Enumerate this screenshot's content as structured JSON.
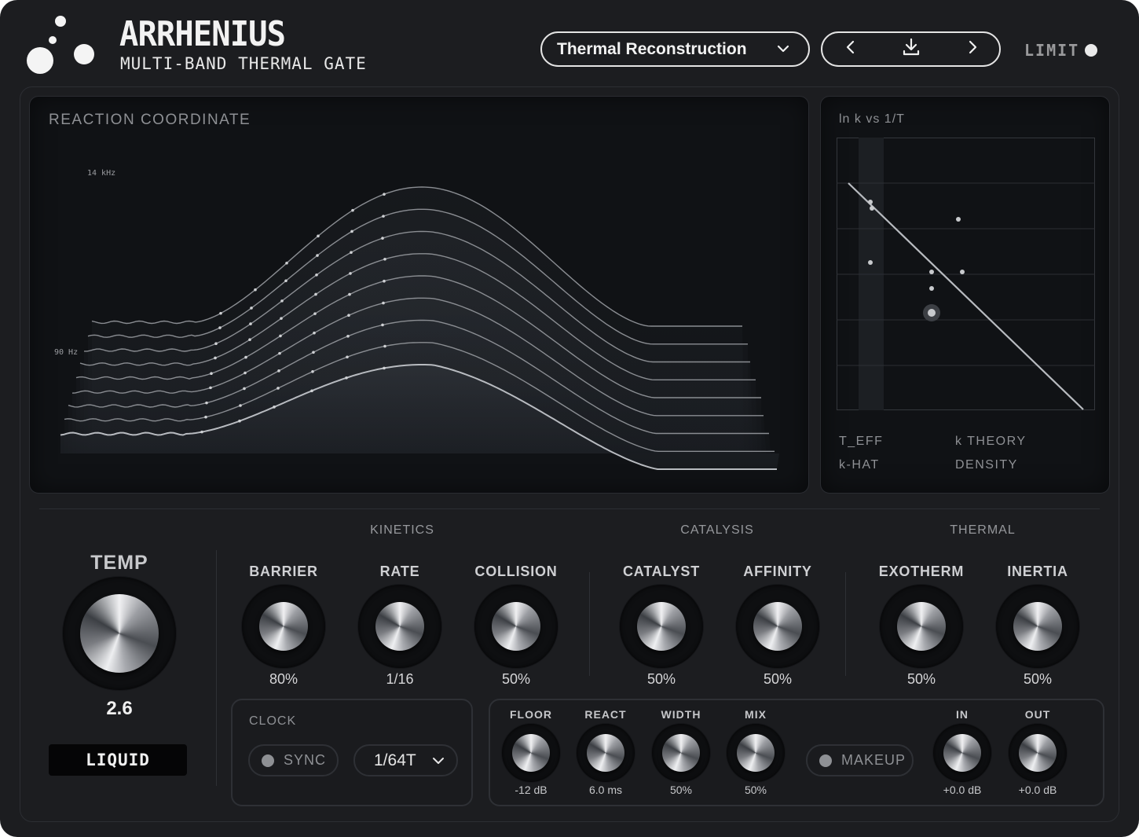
{
  "brand": {
    "title": "ARRHENIUS",
    "subtitle": "MULTI-BAND THERMAL GATE"
  },
  "header": {
    "preset_name": "Thermal Reconstruction",
    "limit_label": "LIMIT",
    "icons": [
      "chevron-down-icon",
      "chevron-left-icon",
      "download-icon",
      "chevron-right-icon"
    ]
  },
  "reaction_panel": {
    "title": "REACTION COORDINATE",
    "freq_top": "14 kHz",
    "freq_mid": "90 Hz"
  },
  "arrhenius_panel": {
    "title": "ln k vs 1/T",
    "stats": [
      "T_EFF",
      "k THEORY",
      "k-HAT",
      "DENSITY"
    ]
  },
  "sections": {
    "kinetics": "KINETICS",
    "catalysis": "CATALYSIS",
    "thermal": "THERMAL"
  },
  "temp": {
    "label": "TEMP",
    "value": "2.6",
    "state": "LIQUID"
  },
  "knobs": [
    {
      "label": "BARRIER",
      "value": "80%"
    },
    {
      "label": "RATE",
      "value": "1/16"
    },
    {
      "label": "COLLISION",
      "value": "50%"
    },
    {
      "label": "CATALYST",
      "value": "50%"
    },
    {
      "label": "AFFINITY",
      "value": "50%"
    },
    {
      "label": "EXOTHERM",
      "value": "50%"
    },
    {
      "label": "INERTIA",
      "value": "50%"
    }
  ],
  "clock": {
    "label": "CLOCK",
    "sync_label": "SYNC",
    "division": "1/64T"
  },
  "dynamics": {
    "knobs": [
      {
        "label": "FLOOR",
        "value": "-12 dB"
      },
      {
        "label": "REACT",
        "value": "6.0 ms"
      },
      {
        "label": "WIDTH",
        "value": "50%"
      },
      {
        "label": "MIX",
        "value": "50%"
      }
    ],
    "makeup_label": "MAKEUP",
    "io": [
      {
        "label": "IN",
        "value": "+0.0 dB"
      },
      {
        "label": "OUT",
        "value": "+0.0 dB"
      }
    ]
  },
  "colors": {
    "background": "#1c1d20",
    "panel": "#101215",
    "text": "#d8d8d8",
    "muted": "#8e9094",
    "accent": "#f2f2f2"
  }
}
